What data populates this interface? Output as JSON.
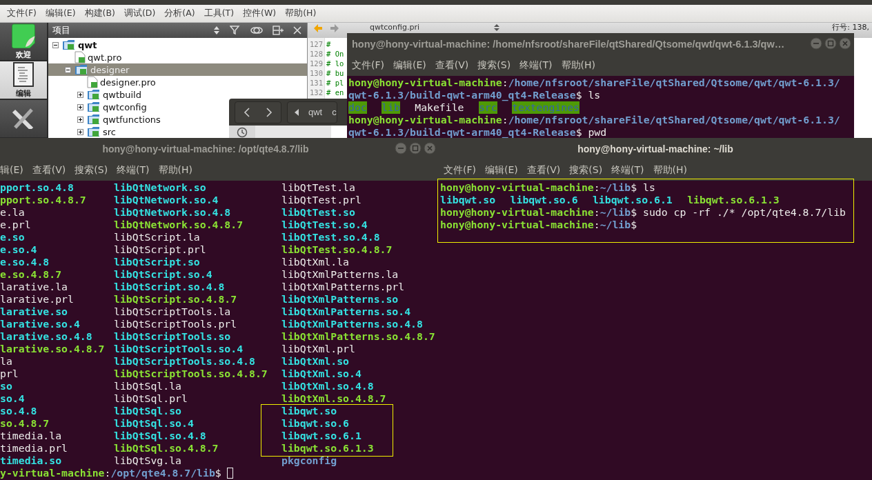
{
  "ide": {
    "menu": [
      "文件(F)",
      "编辑(E)",
      "构建(B)",
      "调试(D)",
      "分析(A)",
      "工具(T)",
      "控件(W)",
      "帮助(H)"
    ],
    "modes": [
      {
        "kind": "welcome",
        "label": "欢迎",
        "selected": false
      },
      {
        "kind": "edit",
        "label": "编辑",
        "selected": true
      },
      {
        "kind": "design",
        "selected": false
      }
    ],
    "projects": {
      "title": "项目",
      "tree": [
        {
          "label": "qwt",
          "kind": "folder",
          "expanded": true,
          "selected": false,
          "children": [
            {
              "label": "qwt.pro",
              "kind": "file",
              "selected": false
            },
            {
              "label": "designer",
              "kind": "folder",
              "expanded": true,
              "selected": true,
              "children": [
                {
                  "label": "designer.pro",
                  "kind": "file",
                  "selected": false
                },
                {
                  "label": "qwtbuild",
                  "kind": "folder",
                  "expanded": false,
                  "selected": false
                },
                {
                  "label": "qwtconfig",
                  "kind": "folder",
                  "expanded": false,
                  "selected": false
                },
                {
                  "label": "qwtfunctions",
                  "kind": "folder",
                  "expanded": false,
                  "selected": false
                },
                {
                  "label": "src",
                  "kind": "folder",
                  "expanded": false,
                  "selected": false
                }
              ]
            }
          ]
        }
      ]
    },
    "editor": {
      "file": "qwtconfig.pri",
      "position": "行号: 138,",
      "lines": [
        {
          "number": "127",
          "text": "#"
        },
        {
          "number": "128",
          "text": "# On"
        },
        {
          "number": "129",
          "text": "# lo"
        },
        {
          "number": "130",
          "text": "# bu"
        },
        {
          "number": "131",
          "text": "# pl"
        },
        {
          "number": "132",
          "text": "# en"
        }
      ]
    }
  },
  "file_browser": {
    "crumbs": [
      "qwt",
      "c"
    ]
  },
  "terminals": [
    {
      "title": "hony@hony-virtual-machine: /home/nfsroot/shareFile/qtShared/Qtsome/qwt/qwt-6.1.3/qw…",
      "focused": false,
      "window_buttons": true,
      "menu": [
        "文件(F)",
        "编辑(E)",
        "查看(V)",
        "搜索(S)",
        "终端(T)",
        "帮助(H)"
      ],
      "lines": [
        {
          "kind": "prompt",
          "segments": [
            {
              "text": "hony@hony-virtual-machine",
              "kind": "user"
            },
            {
              "text": ":",
              "kind": "plain"
            },
            {
              "text": "/home/nfsroot/shareFile/qtShared/Qtsome/qwt/qwt-6.1.3/",
              "kind": "path"
            }
          ]
        },
        {
          "kind": "prompt",
          "segments": [
            {
              "text": "qwt-6.1.3/build-qwt-arm40_qt4-Release",
              "kind": "path"
            },
            {
              "text": "$ ls",
              "kind": "plain"
            }
          ]
        },
        {
          "kind": "listing",
          "segments": [
            {
              "text": "doc",
              "kind": "dir_shared"
            },
            {
              "text": "lib",
              "kind": "dir_shared"
            },
            {
              "text": "Makefile",
              "kind": "file"
            },
            {
              "text": "src",
              "kind": "dir_shared"
            },
            {
              "text": "textengines",
              "kind": "dir_shared"
            }
          ]
        },
        {
          "kind": "prompt",
          "segments": [
            {
              "text": "hony@hony-virtual-machine",
              "kind": "user"
            },
            {
              "text": ":",
              "kind": "plain"
            },
            {
              "text": "/home/nfsroot/shareFile/qtShared/Qtsome/qwt/qwt-6.1.3/",
              "kind": "path"
            }
          ]
        },
        {
          "kind": "prompt",
          "segments": [
            {
              "text": "qwt-6.1.3/build-qwt-arm40_qt4-Release",
              "kind": "path"
            },
            {
              "text": "$ pwd",
              "kind": "plain"
            }
          ]
        }
      ]
    },
    {
      "title": "hony@hony-virtual-machine: /opt/qte4.8.7/lib",
      "focused": false,
      "window_buttons": true,
      "cursor": true,
      "menu": [
        "辑(E)",
        "查看(V)",
        "搜索(S)",
        "终端(T)",
        "帮助(H)"
      ],
      "listing": [
        [
          {
            "text": "pport.so.4.8",
            "kind": "link",
            "highlighted": false
          },
          {
            "text": "pport.so.4.8.7",
            "kind": "exec",
            "highlighted": false
          },
          {
            "text": "e.la",
            "kind": "file",
            "highlighted": false
          },
          {
            "text": "e.prl",
            "kind": "file",
            "highlighted": false
          },
          {
            "text": "e.so",
            "kind": "link",
            "highlighted": false
          },
          {
            "text": "e.so.4",
            "kind": "link",
            "highlighted": false
          },
          {
            "text": "e.so.4.8",
            "kind": "link",
            "highlighted": false
          },
          {
            "text": "e.so.4.8.7",
            "kind": "exec",
            "highlighted": false
          },
          {
            "text": "larative.la",
            "kind": "file",
            "highlighted": false
          },
          {
            "text": "larative.prl",
            "kind": "file",
            "highlighted": false
          },
          {
            "text": "larative.so",
            "kind": "link",
            "highlighted": false
          },
          {
            "text": "larative.so.4",
            "kind": "link",
            "highlighted": false
          },
          {
            "text": "larative.so.4.8",
            "kind": "link",
            "highlighted": false
          },
          {
            "text": "larative.so.4.8.7",
            "kind": "exec",
            "highlighted": false
          },
          {
            "text": "la",
            "kind": "file",
            "highlighted": false
          },
          {
            "text": "prl",
            "kind": "file",
            "highlighted": false
          },
          {
            "text": "so",
            "kind": "link",
            "highlighted": false
          },
          {
            "text": "so.4",
            "kind": "link",
            "highlighted": false
          },
          {
            "text": "so.4.8",
            "kind": "link",
            "highlighted": false
          },
          {
            "text": "so.4.8.7",
            "kind": "exec",
            "highlighted": false
          },
          {
            "text": "timedia.la",
            "kind": "file",
            "highlighted": false
          },
          {
            "text": "timedia.prl",
            "kind": "file",
            "highlighted": false
          },
          {
            "text": "timedia.so",
            "kind": "link",
            "highlighted": false
          }
        ],
        [
          {
            "text": "libQtNetwork.so",
            "kind": "link",
            "highlighted": false
          },
          {
            "text": "libQtNetwork.so.4",
            "kind": "link",
            "highlighted": false
          },
          {
            "text": "libQtNetwork.so.4.8",
            "kind": "link",
            "highlighted": false
          },
          {
            "text": "libQtNetwork.so.4.8.7",
            "kind": "exec",
            "highlighted": false
          },
          {
            "text": "libQtScript.la",
            "kind": "file",
            "highlighted": false
          },
          {
            "text": "libQtScript.prl",
            "kind": "file",
            "highlighted": false
          },
          {
            "text": "libQtScript.so",
            "kind": "link",
            "highlighted": false
          },
          {
            "text": "libQtScript.so.4",
            "kind": "link",
            "highlighted": false
          },
          {
            "text": "libQtScript.so.4.8",
            "kind": "link",
            "highlighted": false
          },
          {
            "text": "libQtScript.so.4.8.7",
            "kind": "exec",
            "highlighted": false
          },
          {
            "text": "libQtScriptTools.la",
            "kind": "file",
            "highlighted": false
          },
          {
            "text": "libQtScriptTools.prl",
            "kind": "file",
            "highlighted": false
          },
          {
            "text": "libQtScriptTools.so",
            "kind": "link",
            "highlighted": false
          },
          {
            "text": "libQtScriptTools.so.4",
            "kind": "link",
            "highlighted": false
          },
          {
            "text": "libQtScriptTools.so.4.8",
            "kind": "link",
            "highlighted": false
          },
          {
            "text": "libQtScriptTools.so.4.8.7",
            "kind": "exec",
            "highlighted": false
          },
          {
            "text": "libQtSql.la",
            "kind": "file",
            "highlighted": false
          },
          {
            "text": "libQtSql.prl",
            "kind": "file",
            "highlighted": false
          },
          {
            "text": "libQtSql.so",
            "kind": "link",
            "highlighted": false
          },
          {
            "text": "libQtSql.so.4",
            "kind": "link",
            "highlighted": false
          },
          {
            "text": "libQtSql.so.4.8",
            "kind": "link",
            "highlighted": false
          },
          {
            "text": "libQtSql.so.4.8.7",
            "kind": "exec",
            "highlighted": false
          },
          {
            "text": "libQtSvg.la",
            "kind": "file",
            "highlighted": false
          }
        ],
        [
          {
            "text": "libQtTest.la",
            "kind": "file",
            "highlighted": false
          },
          {
            "text": "libQtTest.prl",
            "kind": "file",
            "highlighted": false
          },
          {
            "text": "libQtTest.so",
            "kind": "link",
            "highlighted": false
          },
          {
            "text": "libQtTest.so.4",
            "kind": "link",
            "highlighted": false
          },
          {
            "text": "libQtTest.so.4.8",
            "kind": "link",
            "highlighted": false
          },
          {
            "text": "libQtTest.so.4.8.7",
            "kind": "exec",
            "highlighted": false
          },
          {
            "text": "libQtXml.la",
            "kind": "file",
            "highlighted": false
          },
          {
            "text": "libQtXmlPatterns.la",
            "kind": "file",
            "highlighted": false
          },
          {
            "text": "libQtXmlPatterns.prl",
            "kind": "file",
            "highlighted": false
          },
          {
            "text": "libQtXmlPatterns.so",
            "kind": "link",
            "highlighted": false
          },
          {
            "text": "libQtXmlPatterns.so.4",
            "kind": "link",
            "highlighted": false
          },
          {
            "text": "libQtXmlPatterns.so.4.8",
            "kind": "link",
            "highlighted": false
          },
          {
            "text": "libQtXmlPatterns.so.4.8.7",
            "kind": "exec",
            "highlighted": false
          },
          {
            "text": "libQtXml.prl",
            "kind": "file",
            "highlighted": false
          },
          {
            "text": "libQtXml.so",
            "kind": "link",
            "highlighted": false
          },
          {
            "text": "libQtXml.so.4",
            "kind": "link",
            "highlighted": false
          },
          {
            "text": "libQtXml.so.4.8",
            "kind": "link",
            "highlighted": false
          },
          {
            "text": "libQtXml.so.4.8.7",
            "kind": "exec",
            "highlighted": false
          },
          {
            "text": "libqwt.so",
            "kind": "link",
            "highlighted": true
          },
          {
            "text": "libqwt.so.6",
            "kind": "link",
            "highlighted": true
          },
          {
            "text": "libqwt.so.6.1",
            "kind": "link",
            "highlighted": true
          },
          {
            "text": "libqwt.so.6.1.3",
            "kind": "exec",
            "highlighted": true
          },
          {
            "text": "pkgconfig",
            "kind": "dir",
            "highlighted": false
          }
        ]
      ],
      "lines": [
        {
          "kind": "prompt",
          "segments": [
            {
              "text": "y-virtual-machine",
              "kind": "user"
            },
            {
              "text": ":",
              "kind": "plain"
            },
            {
              "text": "/opt/qte4.8.7/lib",
              "kind": "path"
            },
            {
              "text": "$",
              "kind": "plain"
            }
          ]
        }
      ]
    },
    {
      "title": "hony@hony-virtual-machine: ~/lib",
      "focused": true,
      "annotated": true,
      "menu": [
        "文件(F)",
        "编辑(E)",
        "查看(V)",
        "搜索(S)",
        "终端(T)",
        "帮助(H)"
      ],
      "lines": [
        {
          "kind": "prompt",
          "segments": [
            {
              "text": "hony@hony-virtual-machine",
              "kind": "user"
            },
            {
              "text": ":",
              "kind": "plain"
            },
            {
              "text": "~/lib",
              "kind": "path"
            },
            {
              "text": "$ ls",
              "kind": "plain"
            }
          ]
        },
        {
          "kind": "listing",
          "segments": [
            {
              "text": "libqwt.so",
              "kind": "link"
            },
            {
              "text": "libqwt.so.6",
              "kind": "link"
            },
            {
              "text": "libqwt.so.6.1",
              "kind": "link"
            },
            {
              "text": "libqwt.so.6.1.3",
              "kind": "exec"
            }
          ]
        },
        {
          "kind": "prompt",
          "segments": [
            {
              "text": "hony@hony-virtual-machine",
              "kind": "user"
            },
            {
              "text": ":",
              "kind": "plain"
            },
            {
              "text": "~/lib",
              "kind": "path"
            },
            {
              "text": "$ sudo cp -rf ./* /opt/qte4.8.7/lib",
              "kind": "plain"
            }
          ]
        },
        {
          "kind": "prompt",
          "segments": [
            {
              "text": "hony@hony-virtual-machine",
              "kind": "user"
            },
            {
              "text": ":",
              "kind": "plain"
            },
            {
              "text": "~/lib",
              "kind": "path"
            },
            {
              "text": "$",
              "kind": "plain"
            }
          ]
        }
      ]
    }
  ]
}
